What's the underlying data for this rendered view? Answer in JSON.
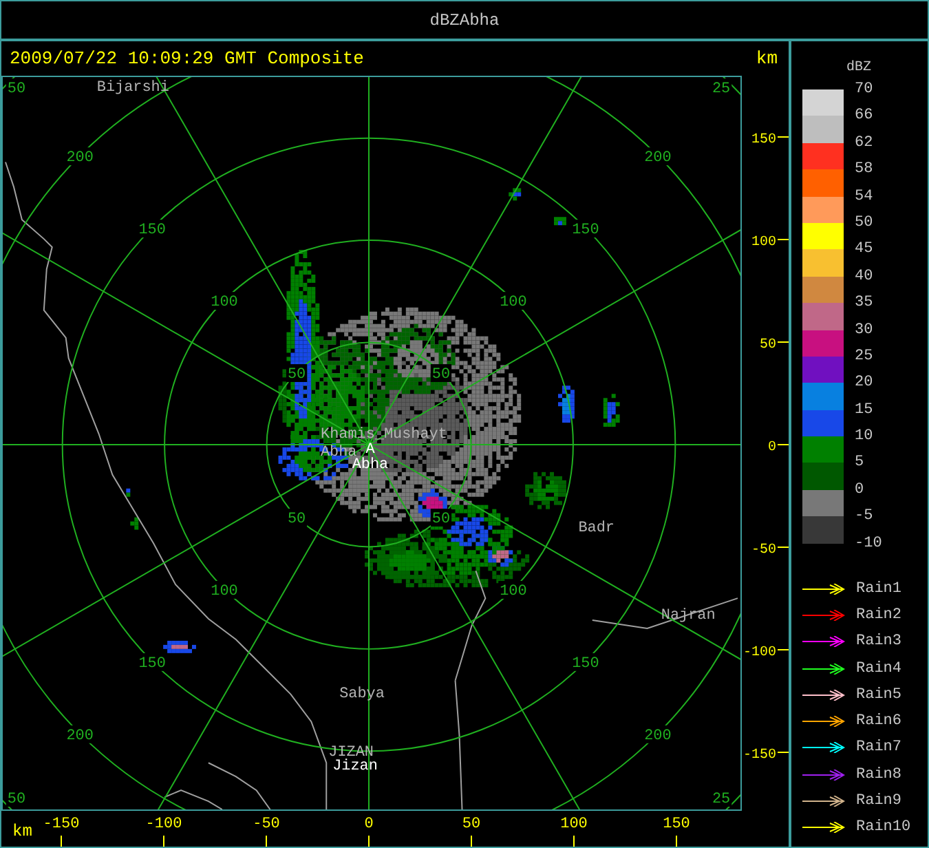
{
  "window": {
    "title": "dBZAbha"
  },
  "header": {
    "timestamp": "2009/07/22 10:09:29 GMT Composite"
  },
  "rings": [
    {
      "labels": [
        "50",
        "50",
        "50",
        "50"
      ]
    },
    {
      "labels": [
        "100",
        "100",
        "100",
        "100"
      ]
    },
    {
      "labels": [
        "150",
        "150",
        "150",
        "150"
      ]
    },
    {
      "labels": [
        "200",
        "200",
        "200",
        "200"
      ]
    },
    {
      "labels": [
        "50",
        "25",
        "50",
        "25"
      ]
    }
  ],
  "places": [
    {
      "name": "Bijarshi",
      "kind": "town"
    },
    {
      "name": "Khamis_Mushayt",
      "kind": "town"
    },
    {
      "name": "Abha",
      "kind": "town"
    },
    {
      "name": "A",
      "kind": "site"
    },
    {
      "name": "Abha",
      "kind": "site"
    },
    {
      "name": "Badr",
      "kind": "town"
    },
    {
      "name": "Najran",
      "kind": "town"
    },
    {
      "name": "Sabya",
      "kind": "town"
    },
    {
      "name": "JIZAN",
      "kind": "town"
    },
    {
      "name": "Jizan",
      "kind": "site"
    }
  ],
  "y_axis": {
    "unit": "km",
    "ticks": [
      "150",
      "100",
      "50",
      "0",
      "-50",
      "-100",
      "-150"
    ]
  },
  "x_axis": {
    "unit": "km",
    "ticks": [
      "-150",
      "-100",
      "-50",
      "0",
      "50",
      "100",
      "150"
    ]
  },
  "scale": {
    "title": "dBZ",
    "labels": [
      "70",
      "66",
      "62",
      "58",
      "54",
      "50",
      "45",
      "40",
      "35",
      "30",
      "25",
      "20",
      "15",
      "10",
      "5",
      "0",
      "-5",
      "-10"
    ],
    "bins": [
      {
        "color": "#d4d4d4"
      },
      {
        "color": "#bebebe"
      },
      {
        "color": "#ff3020"
      },
      {
        "color": "#ff6000"
      },
      {
        "color": "#ff9a5a"
      },
      {
        "color": "#ffff00"
      },
      {
        "color": "#f8c030"
      },
      {
        "color": "#d08840"
      },
      {
        "color": "#c06888"
      },
      {
        "color": "#c81080"
      },
      {
        "color": "#7010c0"
      },
      {
        "color": "#0880e0"
      },
      {
        "color": "#1848e8"
      },
      {
        "color": "#008000"
      },
      {
        "color": "#005800"
      },
      {
        "color": "#787878"
      },
      {
        "color": "#383838"
      }
    ]
  },
  "tracks": [
    {
      "label": "Rain1",
      "color": "#ffff00"
    },
    {
      "label": "Rain2",
      "color": "#ff0000"
    },
    {
      "label": "Rain3",
      "color": "#ff00ff"
    },
    {
      "label": "Rain4",
      "color": "#20ff20"
    },
    {
      "label": "Rain5",
      "color": "#ffc0cb"
    },
    {
      "label": "Rain6",
      "color": "#ffa500"
    },
    {
      "label": "Rain7",
      "color": "#00ffff"
    },
    {
      "label": "Rain8",
      "color": "#a020f0"
    },
    {
      "label": "Rain9",
      "color": "#d2b48c"
    },
    {
      "label": "Rain10",
      "color": "#ffff00"
    }
  ]
}
